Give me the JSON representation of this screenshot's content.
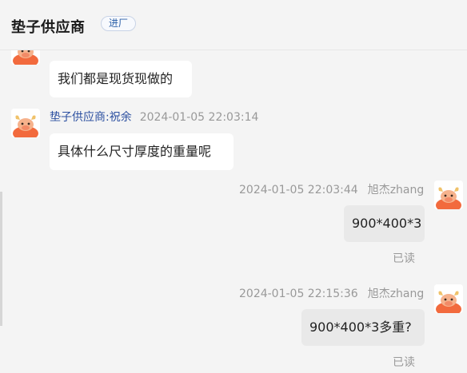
{
  "header": {
    "title": "垫子供应商",
    "badge": "进厂"
  },
  "messages": [
    {
      "direction": "in",
      "text": "我们都是现货现做的"
    },
    {
      "direction": "in",
      "sender": "垫子供应商:祝余",
      "time": "2024-01-05 22:03:14",
      "text": "具体什么尺寸厚度的重量呢"
    },
    {
      "direction": "out",
      "sender": "旭杰zhang",
      "time": "2024-01-05 22:03:44",
      "text": "900*400*3",
      "status": "已读"
    },
    {
      "direction": "out",
      "sender": "旭杰zhang",
      "time": "2024-01-05 22:15:36",
      "text": "900*400*3多重?",
      "status": "已读"
    }
  ],
  "icons": {
    "avatar": "cow-avatar-icon"
  },
  "colors": {
    "sender_name": "#2b4fa0",
    "badge_text": "#2b5fa8",
    "bubble_in": "#ffffff",
    "bubble_out": "#e9e9e9",
    "avatar_orange": "#f26a3d"
  }
}
